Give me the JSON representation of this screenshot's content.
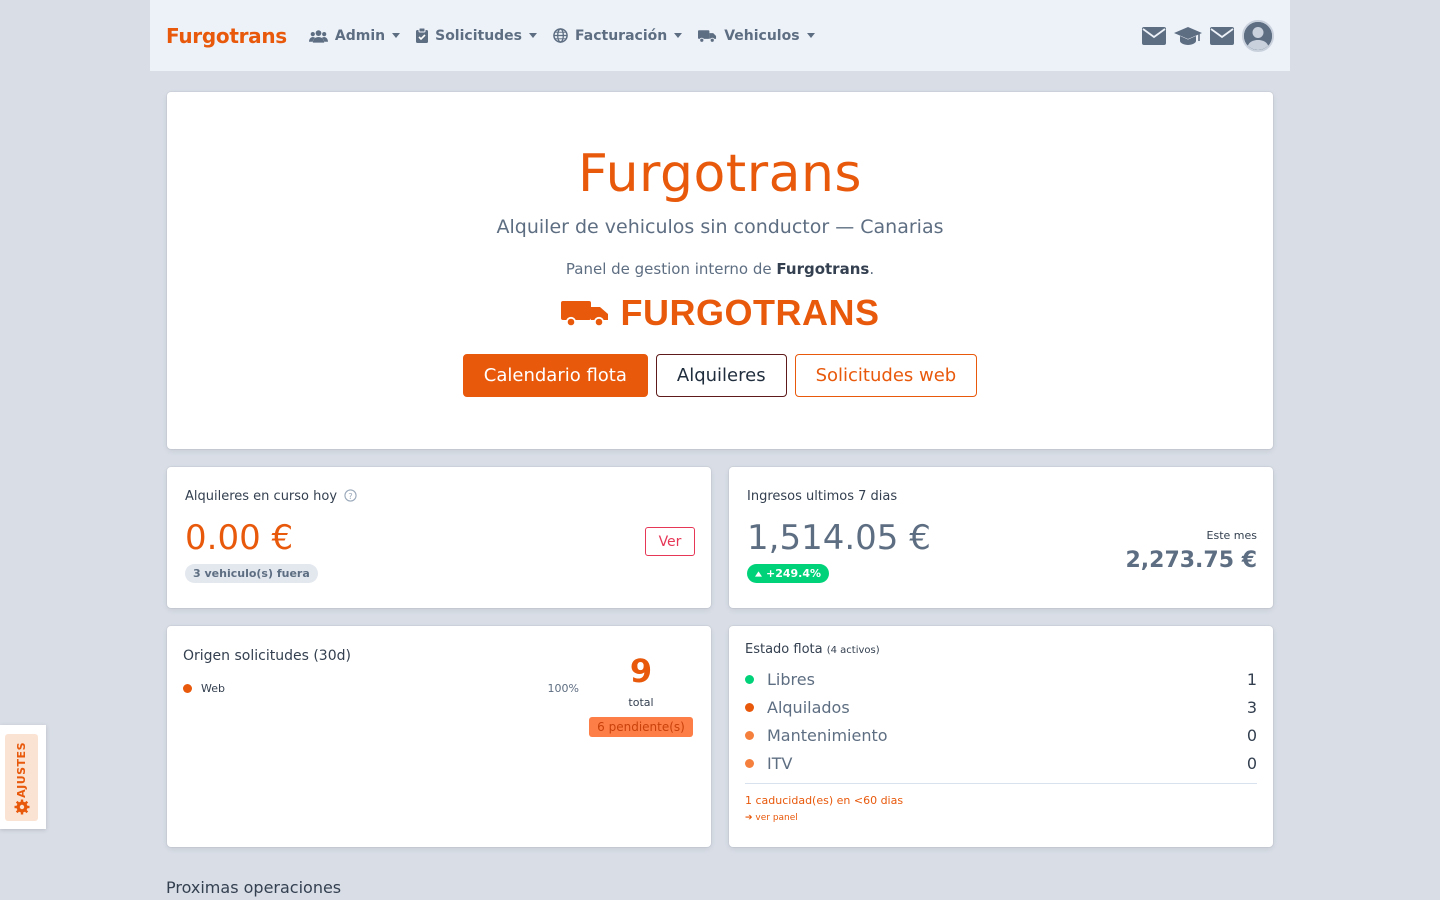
{
  "navbar": {
    "brand": "Furgotrans",
    "menus": [
      {
        "label": "Admin",
        "icon": "users-icon"
      },
      {
        "label": "Solicitudes",
        "icon": "clipboard-check-icon"
      },
      {
        "label": "Facturación",
        "icon": "globe-icon"
      },
      {
        "label": "Vehiculos",
        "icon": "truck-icon"
      }
    ],
    "right_icons": [
      "envelope-icon",
      "graduation-cap-icon",
      "envelope-icon",
      "user-avatar"
    ]
  },
  "hero": {
    "title": "Furgotrans",
    "subtitle": "Alquiler de vehiculos sin conductor — Canarias",
    "desc_prefix": "Panel de gestion interno de ",
    "desc_brand": "Furgotrans",
    "desc_suffix": ".",
    "logo_text": "FURGOTRANS",
    "buttons": {
      "calendar": "Calendario flota",
      "rentals": "Alquileres",
      "web_requests": "Solicitudes web"
    }
  },
  "rentals_today": {
    "title": "Alquileres en curso hoy",
    "amount": "0.00 €",
    "badge": "3 vehiculo(s) fuera",
    "action": "Ver"
  },
  "income": {
    "title": "Ingresos ultimos 7 dias",
    "amount": "1,514.05 €",
    "change": "+249.4%",
    "month_label": "Este mes",
    "month_amount": "2,273.75 €"
  },
  "request_origin": {
    "title": "Origen solicitudes (30d)",
    "rows": [
      {
        "label": "Web",
        "pct": "100%",
        "color": "#e8590c"
      }
    ],
    "total": "9",
    "total_label": "total",
    "pending": "6 pendiente(s)"
  },
  "fleet": {
    "title": "Estado flota",
    "active_note": "(4 activos)",
    "rows": [
      {
        "label": "Libres",
        "count": "1",
        "color": "#00d27a"
      },
      {
        "label": "Alquilados",
        "count": "3",
        "color": "#e8590c"
      },
      {
        "label": "Mantenimiento",
        "count": "0",
        "color": "#f5803e"
      },
      {
        "label": "ITV",
        "count": "0",
        "color": "#f5803e"
      }
    ],
    "expiry_note": "1 caducidad(es) en <60 dias",
    "panel_link": "ver panel"
  },
  "upcoming": {
    "title": "Proximas operaciones"
  },
  "settings": {
    "label": "AJUSTES"
  },
  "colors": {
    "accent": "#e8590c",
    "success": "#00d27a",
    "danger": "#e63757",
    "muted": "#5e6e82"
  }
}
